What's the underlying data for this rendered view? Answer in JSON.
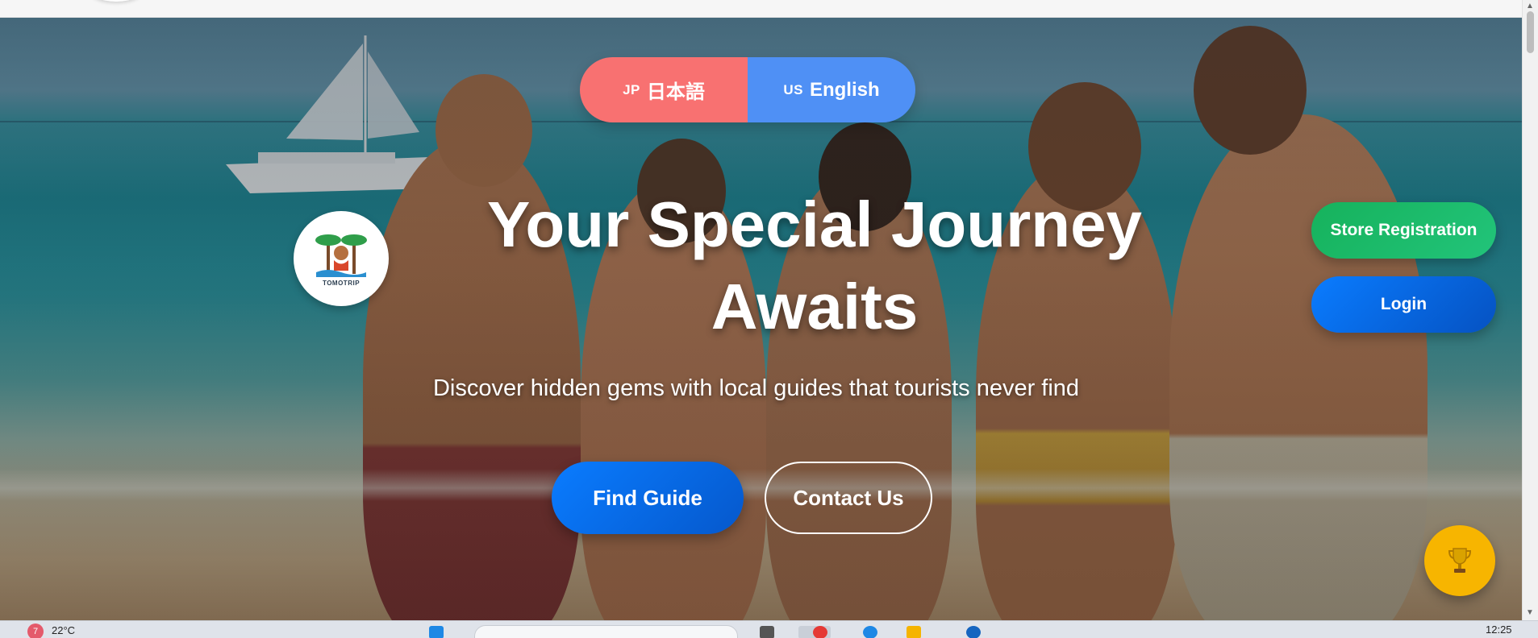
{
  "language_switch": {
    "jp_code": "JP",
    "jp_label": "日本語",
    "en_code": "US",
    "en_label": "English"
  },
  "logo": {
    "text": "TOMOTRIP"
  },
  "hero": {
    "title_line1": "Your Special Journey",
    "title_line2": "Awaits",
    "subtitle": "Discover hidden gems with local guides that tourists never find"
  },
  "buttons": {
    "find_guide": "Find Guide",
    "contact_us": "Contact Us",
    "store_registration": "Store Registration",
    "login": "Login"
  },
  "taskbar": {
    "weather_badge": "7",
    "weather_temp": "22°C",
    "clock": "12:25"
  },
  "colors": {
    "jp_button": "#f87171",
    "en_button": "#4f90f5",
    "primary_blue": "#0a7cff",
    "store_green": "#16b25c",
    "trophy_yellow": "#f7b500"
  }
}
